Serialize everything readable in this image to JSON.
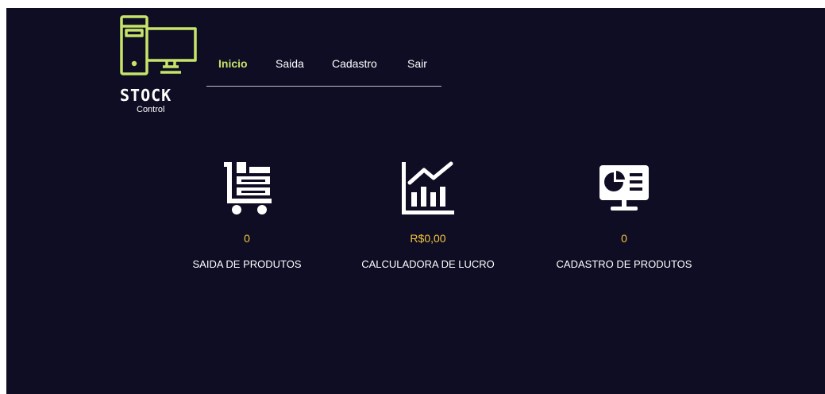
{
  "logo": {
    "title": "STOCK",
    "subtitle": "Control",
    "icon": "computer-tower-monitor-icon",
    "color": "#c6e36a"
  },
  "nav": {
    "items": [
      {
        "label": "Inicio",
        "active": true
      },
      {
        "label": "Saida",
        "active": false
      },
      {
        "label": "Cadastro",
        "active": false
      },
      {
        "label": "Sair",
        "active": false
      }
    ]
  },
  "cards": [
    {
      "icon": "cart-boxes-icon",
      "value": "0",
      "label": "SAIDA DE PRODUTOS"
    },
    {
      "icon": "bar-chart-trend-icon",
      "value": "R$0,00",
      "label": "CALCULADORA DE LUCRO"
    },
    {
      "icon": "presentation-pie-chart-icon",
      "value": "0",
      "label": "CADASTRO DE PRODUTOS"
    }
  ],
  "colors": {
    "background": "#0f0d24",
    "accent": "#c6e36a",
    "value": "#f2c63a",
    "text": "#ffffff"
  }
}
